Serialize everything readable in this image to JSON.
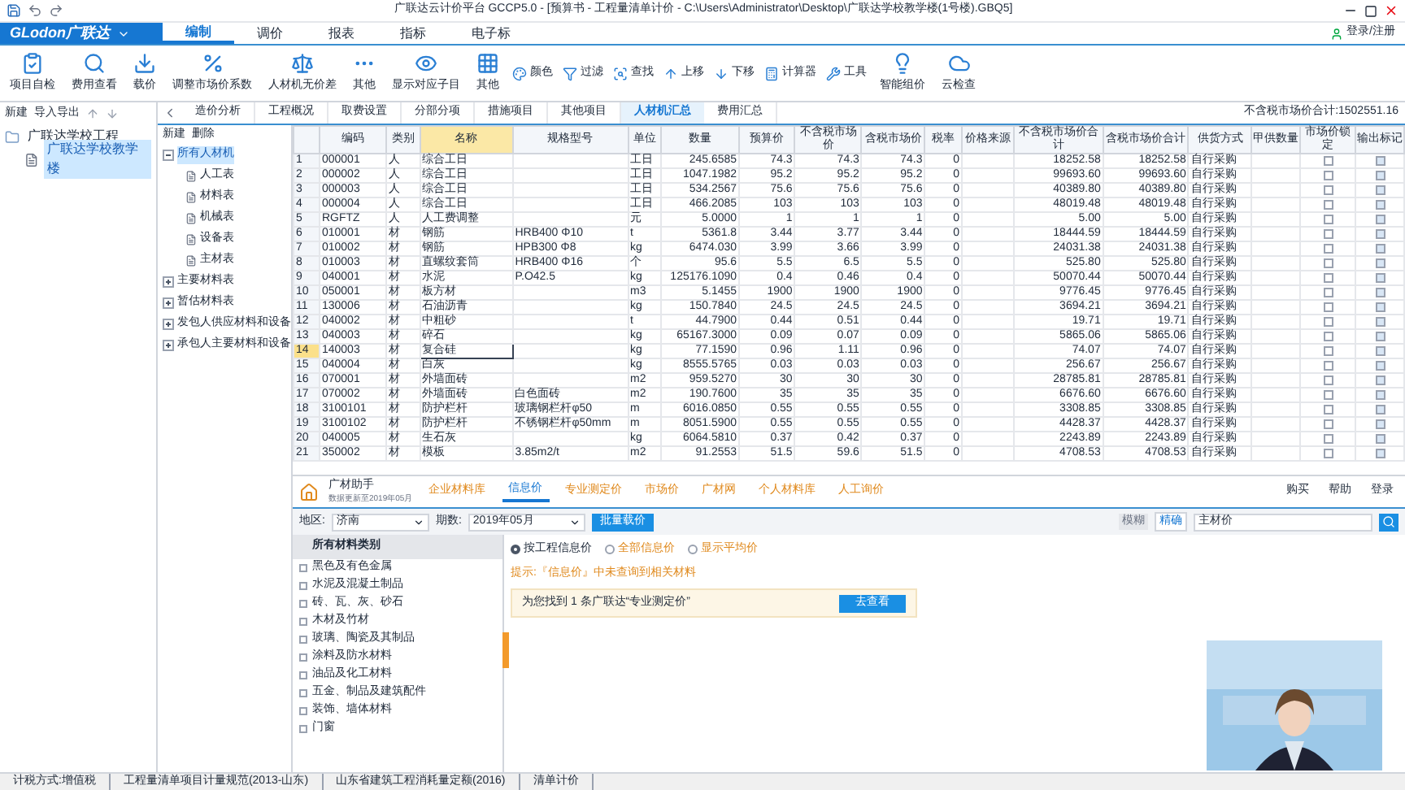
{
  "window": {
    "title": "广联达云计价平台 GCCP5.0 - [预算书 - 工程量清单计价 - C:\\Users\\Administrator\\Desktop\\广联达学校教学楼(1号楼).GBQ5]"
  },
  "menu": {
    "logo": "GLodon广联达",
    "tabs": [
      {
        "label": "编制",
        "selected": true
      },
      {
        "label": "调价",
        "selected": false
      },
      {
        "label": "报表",
        "selected": false
      },
      {
        "label": "指标",
        "selected": false
      },
      {
        "label": "电子标",
        "selected": false
      }
    ],
    "login": "登录/注册"
  },
  "ribbon": [
    {
      "kind": "big",
      "label": "项目自检"
    },
    {
      "kind": "big",
      "label": "费用查看"
    },
    {
      "kind": "big",
      "label": "载价"
    },
    {
      "kind": "big",
      "label": "调整市场价系数"
    },
    {
      "kind": "big",
      "label": "人材机无价差"
    },
    {
      "kind": "big",
      "label": "其他"
    },
    {
      "kind": "big",
      "label": "显示对应子目"
    },
    {
      "kind": "big",
      "label": "其他"
    },
    {
      "kind": "small",
      "label": "颜色"
    },
    {
      "kind": "small",
      "label": "过滤"
    },
    {
      "kind": "small",
      "label": "查找"
    },
    {
      "kind": "small",
      "label": "上移"
    },
    {
      "kind": "small",
      "label": "下移"
    },
    {
      "kind": "small",
      "label": "计算器"
    },
    {
      "kind": "small",
      "label": "工具"
    },
    {
      "kind": "big",
      "label": "智能组价"
    },
    {
      "kind": "big",
      "label": "云检查"
    }
  ],
  "project_tree": {
    "toolbar": [
      "新建",
      "导入导出"
    ],
    "items": [
      {
        "label": "广联达学校工程",
        "selected": false,
        "children": [
          {
            "label": "广联达学校教学楼",
            "selected": true
          }
        ]
      }
    ]
  },
  "page_tabs": [
    {
      "label": "造价分析",
      "selected": false
    },
    {
      "label": "工程概况",
      "selected": false
    },
    {
      "label": "取费设置",
      "selected": false
    },
    {
      "label": "分部分项",
      "selected": false
    },
    {
      "label": "措施项目",
      "selected": false
    },
    {
      "label": "其他项目",
      "selected": false
    },
    {
      "label": "人材机汇总",
      "selected": true
    },
    {
      "label": "费用汇总",
      "selected": false
    }
  ],
  "summary": "不含税市场价合计:1502551.16",
  "category_tree": {
    "toolbar": [
      "新建",
      "删除"
    ],
    "items": [
      {
        "label": "所有人材机",
        "selected": true,
        "expanded": true,
        "children": [
          {
            "label": "人工表"
          },
          {
            "label": "材料表"
          },
          {
            "label": "机械表"
          },
          {
            "label": "设备表"
          },
          {
            "label": "主材表"
          }
        ]
      },
      {
        "label": "主要材料表",
        "selected": false,
        "expanded": false
      },
      {
        "label": "暂估材料表",
        "selected": false,
        "expanded": false
      },
      {
        "label": "发包人供应材料和设备",
        "selected": false,
        "expanded": false
      },
      {
        "label": "承包人主要材料和设备",
        "selected": false,
        "expanded": false
      }
    ]
  },
  "table": {
    "columns": [
      {
        "label": "编码",
        "kind": "text"
      },
      {
        "label": "类别",
        "kind": "text"
      },
      {
        "label": "名称",
        "kind": "text"
      },
      {
        "label": "规格型号",
        "kind": "text"
      },
      {
        "label": "单位",
        "kind": "text"
      },
      {
        "label": "数量",
        "kind": "num"
      },
      {
        "label": "预算价",
        "kind": "num"
      },
      {
        "label": "不含税市场价",
        "kind": "num"
      },
      {
        "label": "含税市场价",
        "kind": "num"
      },
      {
        "label": "税率",
        "kind": "num"
      },
      {
        "label": "价格来源",
        "kind": "text"
      },
      {
        "label": "不含税市场价合计",
        "kind": "num"
      },
      {
        "label": "含税市场价合计",
        "kind": "num"
      },
      {
        "label": "供货方式",
        "kind": "text"
      },
      {
        "label": "甲供数量",
        "kind": "num"
      },
      {
        "label": "市场价锁定",
        "kind": "check"
      },
      {
        "label": "输出标记",
        "kind": "check"
      }
    ],
    "rows": [
      {
        "no": "1",
        "selected": false,
        "locked": false,
        "output": true,
        "cells": [
          "000001",
          "人",
          "综合工日",
          "",
          "工日",
          "245.6585",
          "74.3",
          "74.3",
          "74.3",
          "0",
          "",
          "18252.58",
          "18252.58",
          "自行采购",
          ""
        ]
      },
      {
        "no": "2",
        "selected": false,
        "locked": false,
        "output": true,
        "cells": [
          "000002",
          "人",
          "综合工日",
          "",
          "工日",
          "1047.1982",
          "95.2",
          "95.2",
          "95.2",
          "0",
          "",
          "99693.60",
          "99693.60",
          "自行采购",
          ""
        ]
      },
      {
        "no": "3",
        "selected": false,
        "locked": false,
        "output": true,
        "cells": [
          "000003",
          "人",
          "综合工日",
          "",
          "工日",
          "534.2567",
          "75.6",
          "75.6",
          "75.6",
          "0",
          "",
          "40389.80",
          "40389.80",
          "自行采购",
          ""
        ]
      },
      {
        "no": "4",
        "selected": false,
        "locked": false,
        "output": true,
        "cells": [
          "000004",
          "人",
          "综合工日",
          "",
          "工日",
          "466.2085",
          "103",
          "103",
          "103",
          "0",
          "",
          "48019.48",
          "48019.48",
          "自行采购",
          ""
        ]
      },
      {
        "no": "5",
        "selected": false,
        "locked": false,
        "output": true,
        "cells": [
          "RGFTZ",
          "人",
          "人工费调整",
          "",
          "元",
          "5.0000",
          "1",
          "1",
          "1",
          "0",
          "",
          "5.00",
          "5.00",
          "自行采购",
          ""
        ]
      },
      {
        "no": "6",
        "selected": false,
        "locked": false,
        "output": true,
        "cells": [
          "010001",
          "材",
          "钢筋",
          "HRB400 Φ10",
          "t",
          "5361.8",
          "3.44",
          "3.77",
          "3.44",
          "0",
          "",
          "18444.59",
          "18444.59",
          "自行采购",
          ""
        ]
      },
      {
        "no": "7",
        "selected": false,
        "locked": false,
        "output": true,
        "cells": [
          "010002",
          "材",
          "钢筋",
          "HPB300 Φ8",
          "kg",
          "6474.030",
          "3.99",
          "3.66",
          "3.99",
          "0",
          "",
          "24031.38",
          "24031.38",
          "自行采购",
          ""
        ]
      },
      {
        "no": "8",
        "selected": false,
        "locked": false,
        "output": true,
        "cells": [
          "010003",
          "材",
          "直螺纹套筒",
          "HRB400 Φ16",
          "个",
          "95.6",
          "5.5",
          "6.5",
          "5.5",
          "0",
          "",
          "525.80",
          "525.80",
          "自行采购",
          ""
        ]
      },
      {
        "no": "9",
        "selected": false,
        "locked": false,
        "output": true,
        "cells": [
          "040001",
          "材",
          "水泥",
          "P.O42.5",
          "kg",
          "125176.1090",
          "0.4",
          "0.46",
          "0.4",
          "0",
          "",
          "50070.44",
          "50070.44",
          "自行采购",
          ""
        ]
      },
      {
        "no": "10",
        "selected": false,
        "locked": false,
        "output": true,
        "cells": [
          "050001",
          "材",
          "板方材",
          "",
          "m3",
          "5.1455",
          "1900",
          "1900",
          "1900",
          "0",
          "",
          "9776.45",
          "9776.45",
          "自行采购",
          ""
        ]
      },
      {
        "no": "11",
        "selected": false,
        "locked": false,
        "output": true,
        "cells": [
          "130006",
          "材",
          "石油沥青",
          "",
          "kg",
          "150.7840",
          "24.5",
          "24.5",
          "24.5",
          "0",
          "",
          "3694.21",
          "3694.21",
          "自行采购",
          ""
        ]
      },
      {
        "no": "12",
        "selected": false,
        "locked": false,
        "output": true,
        "cells": [
          "040002",
          "材",
          "中粗砂",
          "",
          "t",
          "44.7900",
          "0.44",
          "0.51",
          "0.44",
          "0",
          "",
          "19.71",
          "19.71",
          "自行采购",
          ""
        ]
      },
      {
        "no": "13",
        "selected": false,
        "locked": false,
        "output": true,
        "cells": [
          "040003",
          "材",
          "碎石",
          "",
          "kg",
          "65167.3000",
          "0.09",
          "0.07",
          "0.09",
          "0",
          "",
          "5865.06",
          "5865.06",
          "自行采购",
          ""
        ]
      },
      {
        "no": "14",
        "selected": true,
        "locked": false,
        "output": true,
        "cells": [
          "140003",
          "材",
          "复合硅",
          "",
          "kg",
          "77.1590",
          "0.96",
          "1.11",
          "0.96",
          "0",
          "",
          "74.07",
          "74.07",
          "自行采购",
          ""
        ]
      },
      {
        "no": "15",
        "selected": false,
        "locked": false,
        "output": true,
        "cells": [
          "040004",
          "材",
          "白灰",
          "",
          "kg",
          "8555.5765",
          "0.03",
          "0.03",
          "0.03",
          "0",
          "",
          "256.67",
          "256.67",
          "自行采购",
          ""
        ]
      },
      {
        "no": "16",
        "selected": false,
        "locked": false,
        "output": true,
        "cells": [
          "070001",
          "材",
          "外墙面砖",
          "",
          "m2",
          "959.5270",
          "30",
          "30",
          "30",
          "0",
          "",
          "28785.81",
          "28785.81",
          "自行采购",
          ""
        ]
      },
      {
        "no": "17",
        "selected": false,
        "locked": false,
        "output": true,
        "cells": [
          "070002",
          "材",
          "外墙面砖",
          "白色面砖",
          "m2",
          "190.7600",
          "35",
          "35",
          "35",
          "0",
          "",
          "6676.60",
          "6676.60",
          "自行采购",
          ""
        ]
      },
      {
        "no": "18",
        "selected": false,
        "locked": false,
        "output": true,
        "cells": [
          "3100101",
          "材",
          "防护栏杆",
          "玻璃钢栏杆φ50",
          "m",
          "6016.0850",
          "0.55",
          "0.55",
          "0.55",
          "0",
          "",
          "3308.85",
          "3308.85",
          "自行采购",
          ""
        ]
      },
      {
        "no": "19",
        "selected": false,
        "locked": false,
        "output": true,
        "cells": [
          "3100102",
          "材",
          "防护栏杆",
          "不锈钢栏杆φ50mm",
          "m",
          "8051.5900",
          "0.55",
          "0.55",
          "0.55",
          "0",
          "",
          "4428.37",
          "4428.37",
          "自行采购",
          ""
        ]
      },
      {
        "no": "20",
        "selected": false,
        "locked": false,
        "output": true,
        "cells": [
          "040005",
          "材",
          "生石灰",
          "",
          "kg",
          "6064.5810",
          "0.37",
          "0.42",
          "0.37",
          "0",
          "",
          "2243.89",
          "2243.89",
          "自行采购",
          ""
        ]
      },
      {
        "no": "21",
        "selected": false,
        "locked": false,
        "output": true,
        "cells": [
          "350002",
          "材",
          "模板",
          "3.85m2/t",
          "m2",
          "91.2553",
          "51.5",
          "59.6",
          "51.5",
          "0",
          "",
          "4708.53",
          "4708.53",
          "自行采购",
          ""
        ]
      }
    ]
  },
  "assistant": {
    "title": "广材助手",
    "subtitle": "数据更新至2019年05月",
    "tabs": [
      {
        "label": "企业材料库",
        "selected": false
      },
      {
        "label": "信息价",
        "selected": true
      },
      {
        "label": "专业测定价",
        "selected": false
      },
      {
        "label": "市场价",
        "selected": false
      },
      {
        "label": "广材网",
        "selected": false
      },
      {
        "label": "个人材料库",
        "selected": false
      },
      {
        "label": "人工询价",
        "selected": false
      }
    ],
    "right_links": [
      "购买",
      "帮助",
      "登录"
    ],
    "region_label": "地区:",
    "region": "济南",
    "period_label": "期数:",
    "period": "2019年05月",
    "batch_button": "批量载价",
    "categories": [
      "所有材料类别",
      "黑色及有色金属",
      "水泥及混凝土制品",
      "砖、瓦、灰、砂石",
      "木材及竹材",
      "玻璃、陶瓷及其制品",
      "涂料及防水材料",
      "油品及化工材料",
      "五金、制品及建筑配件",
      "装饰、墙体材料",
      "门窗"
    ],
    "options": [
      {
        "label": "按工程信息价",
        "selected": true
      },
      {
        "label": "全部信息价",
        "selected": false
      },
      {
        "label": "显示平均价",
        "selected": false
      }
    ],
    "search_modes": [
      {
        "label": "模糊",
        "selected": false
      },
      {
        "label": "精确",
        "selected": true
      }
    ],
    "search_value": "主材价",
    "notice": "提示:『信息价』中未查询到相关材料",
    "result": "为您找到 1 条广联达“专业测定价”",
    "result_button": "去查看"
  },
  "status_bar": [
    "计税方式:增值税",
    "工程量清单项目计量规范(2013-山东)",
    "山东省建筑工程消耗量定额(2016)",
    "清单计价"
  ]
}
